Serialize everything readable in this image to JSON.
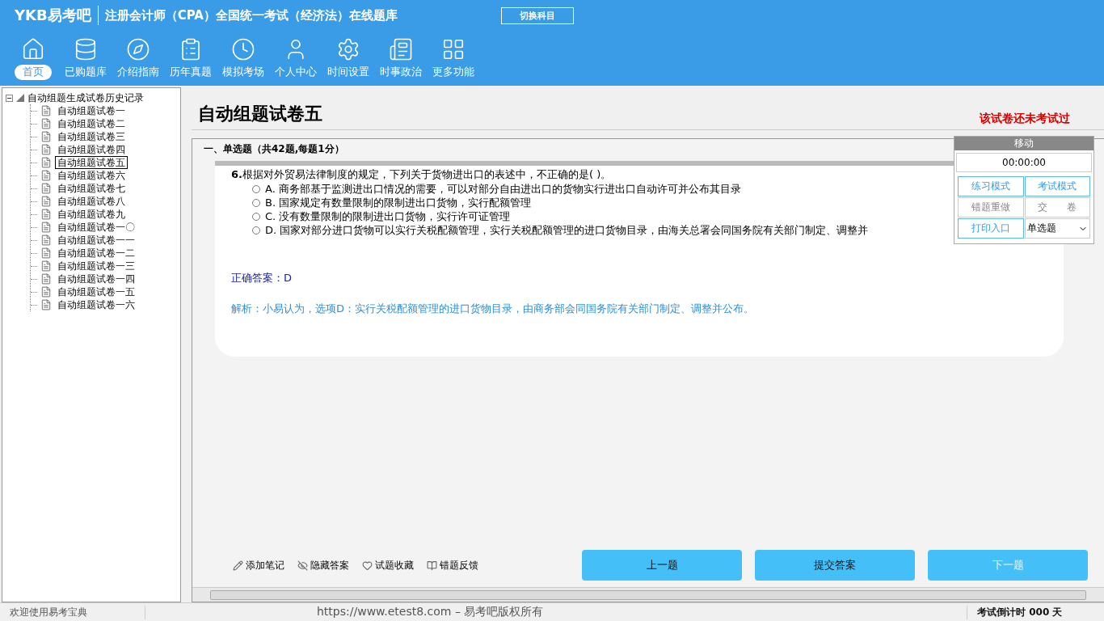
{
  "header": {
    "logo": "YKB易考吧",
    "title": "注册会计师（CPA）全国统一考试（经济法）在线题库",
    "switch_button": "切换科目"
  },
  "toolbar": [
    {
      "label": "首页",
      "selected": true
    },
    {
      "label": "已购题库",
      "selected": false
    },
    {
      "label": "介绍指南",
      "selected": false
    },
    {
      "label": "历年真题",
      "selected": false
    },
    {
      "label": "模拟考场",
      "selected": false
    },
    {
      "label": "个人中心",
      "selected": false
    },
    {
      "label": "时间设置",
      "selected": false
    },
    {
      "label": "时事政治",
      "selected": false
    },
    {
      "label": "更多功能",
      "selected": false
    }
  ],
  "tree": {
    "label": "自动组题生成试卷历史记录",
    "expanded": true,
    "children": [
      {
        "label": "自动组题试卷一",
        "selected": false
      },
      {
        "label": "自动组题试卷二",
        "selected": false
      },
      {
        "label": "自动组题试卷三",
        "selected": false
      },
      {
        "label": "自动组题试卷四",
        "selected": false
      },
      {
        "label": "自动组题试卷五",
        "selected": true
      },
      {
        "label": "自动组题试卷六",
        "selected": false
      },
      {
        "label": "自动组题试卷七",
        "selected": false
      },
      {
        "label": "自动组题试卷八",
        "selected": false
      },
      {
        "label": "自动组题试卷九",
        "selected": false
      },
      {
        "label": "自动组题试卷一〇",
        "selected": false
      },
      {
        "label": "自动组题试卷一一",
        "selected": false
      },
      {
        "label": "自动组题试卷一二",
        "selected": false
      },
      {
        "label": "自动组题试卷一三",
        "selected": false
      },
      {
        "label": "自动组题试卷一四",
        "selected": false
      },
      {
        "label": "自动组题试卷一五",
        "selected": false
      },
      {
        "label": "自动组题试卷一六",
        "selected": false
      }
    ]
  },
  "paper": {
    "title": "自动组题试卷五",
    "status": "该试卷还未考试过"
  },
  "section": "一、单选题（共42题,每题1分）",
  "question": {
    "number": "6.",
    "text": "根据对外贸易法律制度的规定，下列关于货物进出口的表述中，不正确的是( )。",
    "options": [
      {
        "text": "A. 商务部基于监测进出口情况的需要，可以对部分自由进出口的货物实行进出口自动许可并公布其目录",
        "checked": false
      },
      {
        "text": "B. 国家规定有数量限制的限制进出口货物，实行配额管理",
        "checked": false
      },
      {
        "text": "C. 没有数量限制的限制进出口货物，实行许可证管理",
        "checked": false
      },
      {
        "text": "D. 国家对部分进口货物可以实行关税配额管理，实行关税配额管理的进口货物目录，由海关总署会同国务院有关部门制定、调整并",
        "checked": false
      }
    ],
    "answer": "正确答案：D",
    "analysis": "解析：小易认为，选项D：实行关税配额管理的进口货物目录，由商务部会同国务院有关部门制定、调整并公布。"
  },
  "actions": [
    {
      "label": "添加笔记"
    },
    {
      "label": "隐藏答案"
    },
    {
      "label": "试题收藏"
    },
    {
      "label": "错题反馈"
    }
  ],
  "nav_buttons": [
    {
      "label": "上一题",
      "disabled": false
    },
    {
      "label": "提交答案",
      "disabled": false
    },
    {
      "label": "下一题",
      "disabled": true
    }
  ],
  "panel": {
    "title": "移动",
    "timer": "00:00:00",
    "buttons": [
      {
        "label": "练习模式",
        "disabled": false
      },
      {
        "label": "考试模式",
        "disabled": false
      },
      {
        "label": "错题重做",
        "disabled": true
      },
      {
        "label": "交　　卷",
        "disabled": true
      },
      {
        "label": "打印入口",
        "disabled": false
      }
    ],
    "type_select": "单选题"
  },
  "status_bar": {
    "welcome": "欢迎使用易考宝典",
    "copyright": "https://www.etest8.com – 易考吧版权所有",
    "countdown": "考试倒计时 000 天"
  }
}
